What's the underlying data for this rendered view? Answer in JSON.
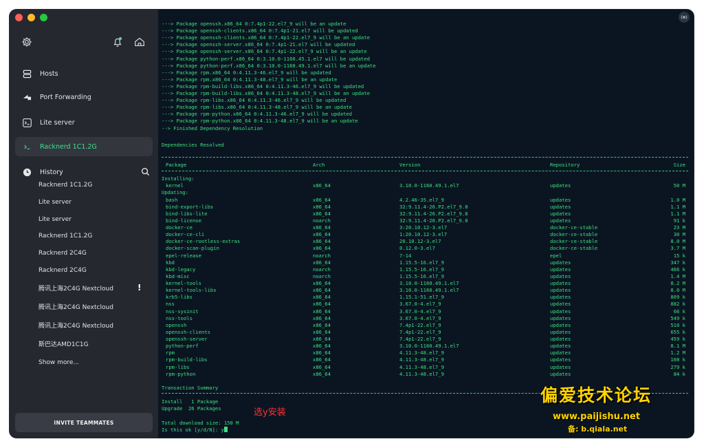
{
  "sidebar": {
    "nav": [
      {
        "label": "Hosts",
        "icon": "hosts-icon"
      },
      {
        "label": "Port Forwarding",
        "icon": "port-forwarding-icon"
      },
      {
        "label": "Lite server",
        "icon": "terminal-icon"
      },
      {
        "label": "Racknerd 1C1.2G",
        "icon": "terminal-icon"
      }
    ],
    "history_title": "History",
    "history": [
      "Racknerd 1C1.2G",
      "Lite server",
      "Lite server",
      "Racknerd 1C1.2G",
      "Racknerd 2C4G",
      "Racknerd 2C4G",
      "腾讯上海2C4G Nextcloud",
      "腾讯上海2C4G Nextcloud",
      "腾讯上海2C4G Nextcloud",
      "斯巴达AMD1C1G",
      "Show more..."
    ],
    "alert_mark": "!",
    "invite_label": "INVITE TEAMMATES"
  },
  "terminal": {
    "top_lines": [
      "---> Package openssh.x86_64 0:7.4p1-22.el7_9 will be an update",
      "---> Package openssh-clients.x86_64 0:7.4p1-21.el7 will be updated",
      "---> Package openssh-clients.x86_64 0:7.4p1-22.el7_9 will be an update",
      "---> Package openssh-server.x86_64 0:7.4p1-21.el7 will be updated",
      "---> Package openssh-server.x86_64 0:7.4p1-22.el7_9 will be an update",
      "---> Package python-perf.x86_64 0:3.10.0-1160.45.1.el7 will be updated",
      "---> Package python-perf.x86_64 0:3.10.0-1160.49.1.el7 will be an update",
      "---> Package rpm.x86_64 0:4.11.3-46.el7_9 will be updated",
      "---> Package rpm.x86_64 0:4.11.3-48.el7_9 will be an update",
      "---> Package rpm-build-libs.x86_64 0:4.11.3-46.el7_9 will be updated",
      "---> Package rpm-build-libs.x86_64 0:4.11.3-48.el7_9 will be an update",
      "---> Package rpm-libs.x86_64 0:4.11.3-46.el7_9 will be updated",
      "---> Package rpm-libs.x86_64 0:4.11.3-48.el7_9 will be an update",
      "---> Package rpm-python.x86_64 0:4.11.3-46.el7_9 will be updated",
      "---> Package rpm-python.x86_64 0:4.11.3-48.el7_9 will be an update",
      "--> Finished Dependency Resolution"
    ],
    "deps_resolved": "Dependencies Resolved",
    "headers": [
      "Package",
      "Arch",
      "Version",
      "Repository",
      "Size"
    ],
    "installing_label": "Installing:",
    "installing": [
      [
        "kernel",
        "x86_64",
        "3.10.0-1160.49.1.el7",
        "updates",
        "50 M"
      ]
    ],
    "updating_label": "Updating:",
    "updating": [
      [
        "bash",
        "x86_64",
        "4.2.46-35.el7_9",
        "updates",
        "1.0 M"
      ],
      [
        "bind-export-libs",
        "x86_64",
        "32:9.11.4-26.P2.el7_9.8",
        "updates",
        "1.1 M"
      ],
      [
        "bind-libs-lite",
        "x86_64",
        "32:9.11.4-26.P2.el7_9.8",
        "updates",
        "1.1 M"
      ],
      [
        "bind-license",
        "noarch",
        "32:9.11.4-26.P2.el7_9.8",
        "updates",
        "91 k"
      ],
      [
        "docker-ce",
        "x86_64",
        "3:20.10.12-3.el7",
        "docker-ce-stable",
        "23 M"
      ],
      [
        "docker-ce-cli",
        "x86_64",
        "1:20.10.12-3.el7",
        "docker-ce-stable",
        "30 M"
      ],
      [
        "docker-ce-rootless-extras",
        "x86_64",
        "20.10.12-3.el7",
        "docker-ce-stable",
        "8.0 M"
      ],
      [
        "docker-scan-plugin",
        "x86_64",
        "0.12.0-3.el7",
        "docker-ce-stable",
        "3.7 M"
      ],
      [
        "epel-release",
        "noarch",
        "7-14",
        "epel",
        "15 k"
      ],
      [
        "kbd",
        "x86_64",
        "1.15.5-16.el7_9",
        "updates",
        "347 k"
      ],
      [
        "kbd-legacy",
        "noarch",
        "1.15.5-16.el7_9",
        "updates",
        "466 k"
      ],
      [
        "kbd-misc",
        "noarch",
        "1.15.5-16.el7_9",
        "updates",
        "1.4 M"
      ],
      [
        "kernel-tools",
        "x86_64",
        "3.10.0-1160.49.1.el7",
        "updates",
        "8.2 M"
      ],
      [
        "kernel-tools-libs",
        "x86_64",
        "3.10.0-1160.49.1.el7",
        "updates",
        "8.0 M"
      ],
      [
        "krb5-libs",
        "x86_64",
        "1.15.1-51.el7_9",
        "updates",
        "809 k"
      ],
      [
        "nss",
        "x86_64",
        "3.67.0-4.el7_9",
        "updates",
        "882 k"
      ],
      [
        "nss-sysinit",
        "x86_64",
        "3.67.0-4.el7_9",
        "updates",
        "66 k"
      ],
      [
        "nss-tools",
        "x86_64",
        "3.67.0-4.el7_9",
        "updates",
        "549 k"
      ],
      [
        "openssh",
        "x86_64",
        "7.4p1-22.el7_9",
        "updates",
        "510 k"
      ],
      [
        "openssh-clients",
        "x86_64",
        "7.4p1-22.el7_9",
        "updates",
        "655 k"
      ],
      [
        "openssh-server",
        "x86_64",
        "7.4p1-22.el7_9",
        "updates",
        "459 k"
      ],
      [
        "python-perf",
        "x86_64",
        "3.10.0-1160.49.1.el7",
        "updates",
        "8.1 M"
      ],
      [
        "rpm",
        "x86_64",
        "4.11.3-48.el7_9",
        "updates",
        "1.2 M"
      ],
      [
        "rpm-build-libs",
        "x86_64",
        "4.11.3-48.el7_9",
        "updates",
        "108 k"
      ],
      [
        "rpm-libs",
        "x86_64",
        "4.11.3-48.el7_9",
        "updates",
        "279 k"
      ],
      [
        "rpm-python",
        "x86_64",
        "4.11.3-48.el7_9",
        "updates",
        "84 k"
      ]
    ],
    "summary_title": "Transaction Summary",
    "install_line": "Install   1 Package",
    "upgrade_line": "Upgrade  26 Packages",
    "download_line": "Total download size: 150 M",
    "prompt_line": "Is this ok [y/d/N]: y",
    "annotation": "选y安装",
    "watermark_title": "偏爱技术论坛",
    "watermark_url": "www.paijishu.net",
    "watermark_sub": "备: b.qiala.net"
  },
  "colors": {
    "terminal_bg": "#0b1522",
    "terminal_text": "#3ee07e",
    "sidebar_bg": "#262830",
    "active_green": "#3fe08a",
    "annotation_red": "#ff3030",
    "watermark_yellow": "#ffd400"
  }
}
